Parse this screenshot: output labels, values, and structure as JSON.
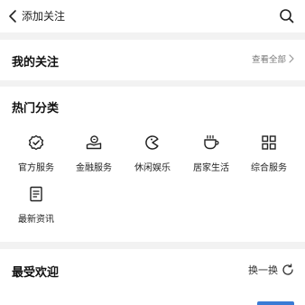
{
  "header": {
    "title": "添加关注",
    "back_icon": "chevron-left-icon",
    "search_icon": "search-icon"
  },
  "my_follow": {
    "title": "我的关注",
    "view_all_label": "查看全部",
    "chevron_icon": "chevron-right-icon"
  },
  "hot_categories": {
    "title": "热门分类",
    "items": [
      {
        "label": "官方服务",
        "icon": "verified-badge-icon"
      },
      {
        "label": "金融服务",
        "icon": "finance-hand-icon"
      },
      {
        "label": "休闲娱乐",
        "icon": "pacman-icon"
      },
      {
        "label": "居家生活",
        "icon": "cup-icon"
      },
      {
        "label": "综合服务",
        "icon": "grid-icon"
      },
      {
        "label": "最新资讯",
        "icon": "document-icon"
      }
    ]
  },
  "popular": {
    "title": "最受欢迎",
    "refresh_label": "换一换",
    "refresh_icon": "refresh-icon",
    "first_item_partial": "……"
  },
  "colors": {
    "accent_blue": "#3a7bd5",
    "background": "#f2f2f2",
    "card": "#ffffff"
  }
}
